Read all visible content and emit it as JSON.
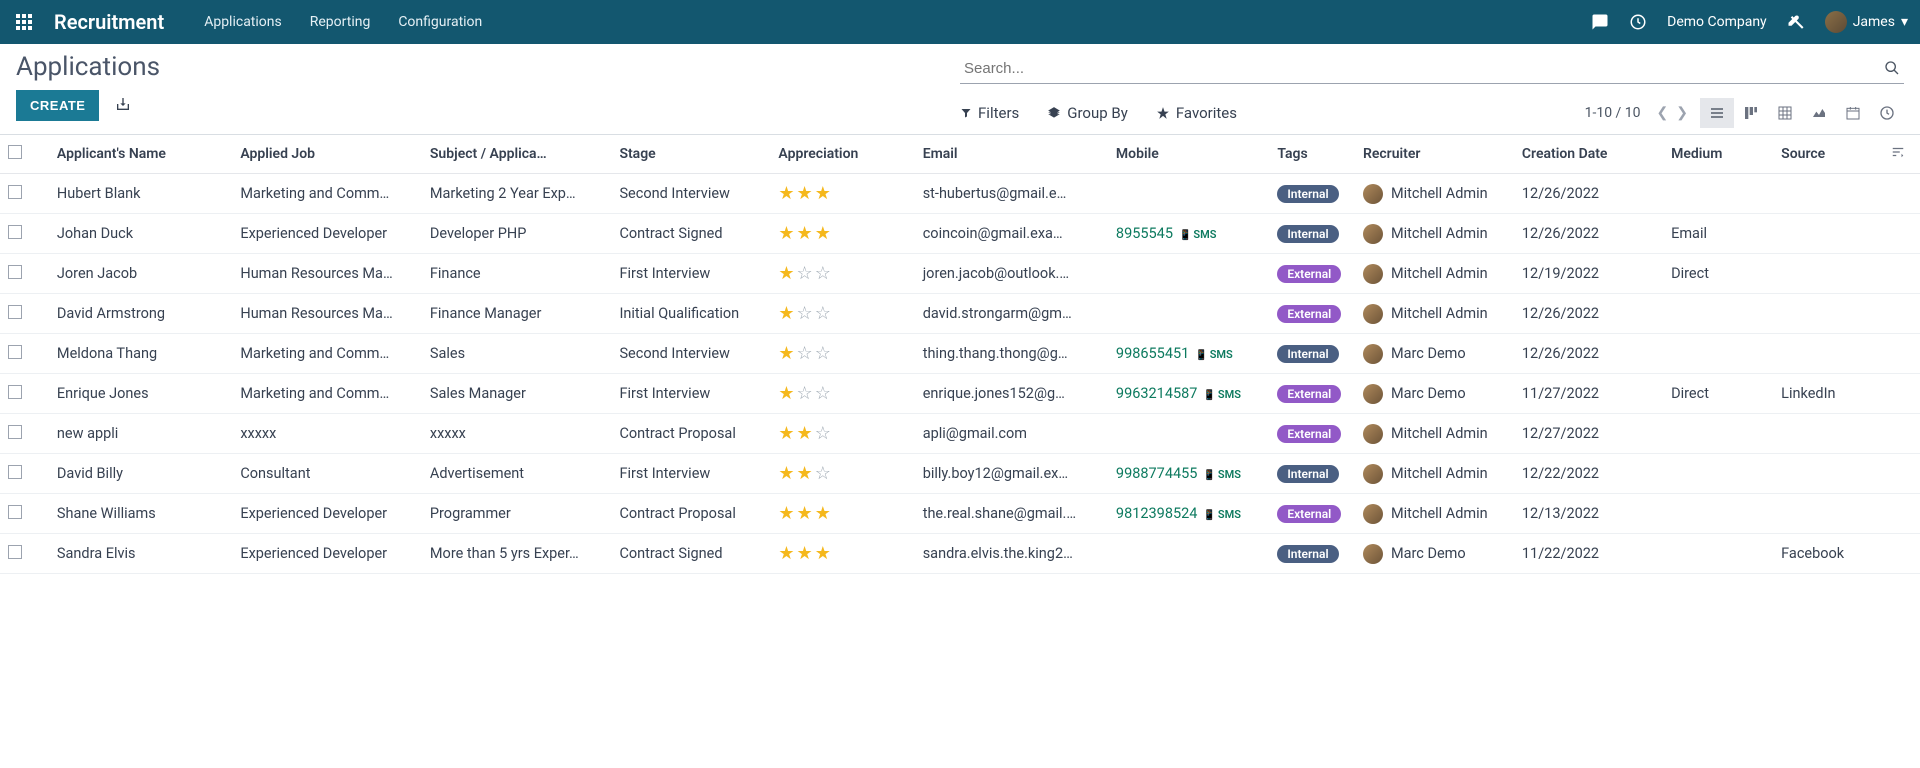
{
  "header": {
    "module": "Recruitment",
    "nav": [
      "Applications",
      "Reporting",
      "Configuration"
    ],
    "company": "Demo Company",
    "user": "James"
  },
  "page": {
    "title": "Applications",
    "create_label": "CREATE",
    "search_placeholder": "Search...",
    "filters_label": "Filters",
    "groupby_label": "Group By",
    "favorites_label": "Favorites",
    "pager": "1-10 / 10"
  },
  "columns": {
    "name": "Applicant's Name",
    "job": "Applied Job",
    "subject": "Subject / Applica…",
    "stage": "Stage",
    "appreciation": "Appreciation",
    "email": "Email",
    "mobile": "Mobile",
    "tags": "Tags",
    "recruiter": "Recruiter",
    "date": "Creation Date",
    "medium": "Medium",
    "source": "Source"
  },
  "rows": [
    {
      "name": "Hubert Blank",
      "job": "Marketing and Comm…",
      "subject": "Marketing 2 Year Exp…",
      "stage": "Second Interview",
      "stars": 3,
      "email": "st-hubertus@gmail.e…",
      "mobile": "",
      "sms": false,
      "tag": "Internal",
      "tag_type": "internal",
      "recruiter": "Mitchell Admin",
      "date": "12/26/2022",
      "medium": "",
      "source": ""
    },
    {
      "name": "Johan Duck",
      "job": "Experienced Developer",
      "subject": "Developer PHP",
      "stage": "Contract Signed",
      "stars": 3,
      "email": "coincoin@gmail.exa…",
      "mobile": "8955545",
      "sms": true,
      "tag": "Internal",
      "tag_type": "internal",
      "recruiter": "Mitchell Admin",
      "date": "12/26/2022",
      "medium": "Email",
      "source": ""
    },
    {
      "name": "Joren Jacob",
      "job": "Human Resources Ma…",
      "subject": "Finance",
      "stage": "First Interview",
      "stars": 1,
      "email": "joren.jacob@outlook.…",
      "mobile": "",
      "sms": false,
      "tag": "External",
      "tag_type": "external",
      "recruiter": "Mitchell Admin",
      "date": "12/19/2022",
      "medium": "Direct",
      "source": ""
    },
    {
      "name": "David Armstrong",
      "job": "Human Resources Ma…",
      "subject": "Finance Manager",
      "stage": "Initial Qualification",
      "stars": 1,
      "email": "david.strongarm@gm…",
      "mobile": "",
      "sms": false,
      "tag": "External",
      "tag_type": "external",
      "recruiter": "Mitchell Admin",
      "date": "12/26/2022",
      "medium": "",
      "source": ""
    },
    {
      "name": "Meldona Thang",
      "job": "Marketing and Comm…",
      "subject": "Sales",
      "stage": "Second Interview",
      "stars": 1,
      "email": "thing.thang.thong@g…",
      "mobile": "998655451",
      "sms": true,
      "tag": "Internal",
      "tag_type": "internal",
      "recruiter": "Marc Demo",
      "date": "12/26/2022",
      "medium": "",
      "source": ""
    },
    {
      "name": "Enrique Jones",
      "job": "Marketing and Comm…",
      "subject": "Sales Manager",
      "stage": "First Interview",
      "stars": 1,
      "email": "enrique.jones152@g…",
      "mobile": "9963214587",
      "sms": true,
      "tag": "External",
      "tag_type": "external",
      "recruiter": "Marc Demo",
      "date": "11/27/2022",
      "medium": "Direct",
      "source": "LinkedIn"
    },
    {
      "name": "new appli",
      "job": "xxxxx",
      "subject": "xxxxx",
      "stage": "Contract Proposal",
      "stars": 2,
      "email": "apli@gmail.com",
      "mobile": "",
      "sms": false,
      "tag": "External",
      "tag_type": "external",
      "recruiter": "Mitchell Admin",
      "date": "12/27/2022",
      "medium": "",
      "source": ""
    },
    {
      "name": "David Billy",
      "job": "Consultant",
      "subject": "Advertisement",
      "stage": "First Interview",
      "stars": 2,
      "email": "billy.boy12@gmail.ex…",
      "mobile": "9988774455",
      "sms": true,
      "tag": "Internal",
      "tag_type": "internal",
      "recruiter": "Mitchell Admin",
      "date": "12/22/2022",
      "medium": "",
      "source": ""
    },
    {
      "name": "Shane Williams",
      "job": "Experienced Developer",
      "subject": "Programmer",
      "stage": "Contract Proposal",
      "stars": 3,
      "email": "the.real.shane@gmail.…",
      "mobile": "9812398524",
      "sms": true,
      "tag": "External",
      "tag_type": "external",
      "recruiter": "Mitchell Admin",
      "date": "12/13/2022",
      "medium": "",
      "source": ""
    },
    {
      "name": "Sandra Elvis",
      "job": "Experienced Developer",
      "subject": "More than 5 yrs Exper…",
      "stage": "Contract Signed",
      "stars": 3,
      "email": "sandra.elvis.the.king2…",
      "mobile": "",
      "sms": false,
      "tag": "Internal",
      "tag_type": "internal",
      "recruiter": "Marc Demo",
      "date": "11/22/2022",
      "medium": "",
      "source": "Facebook"
    }
  ]
}
